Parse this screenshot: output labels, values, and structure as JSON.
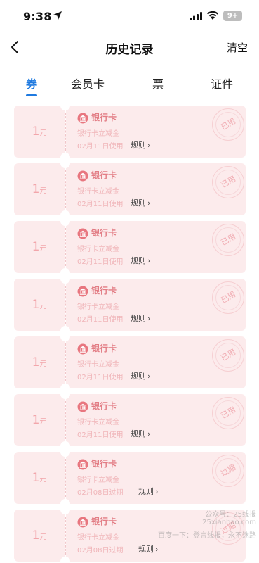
{
  "status": {
    "time": "9:38",
    "battery": "9+"
  },
  "nav": {
    "title": "历史记录",
    "clear_label": "清空",
    "back_icon": "chevron-left-icon"
  },
  "tabs": [
    "券",
    "会员卡",
    "票",
    "证件"
  ],
  "active_tab": "券",
  "colors": {
    "accent": "#1f7ae0",
    "coupon_bg": "#fcebec",
    "coupon_text": "#f0b5b9"
  },
  "coupons": [
    {
      "amount": "1",
      "unit": "元",
      "title": "银行卡",
      "subtitle": "银行卡立减金",
      "date": "02月11日使用",
      "rule": "规则",
      "stamp": "已用"
    },
    {
      "amount": "1",
      "unit": "元",
      "title": "银行卡",
      "subtitle": "银行卡立减金",
      "date": "02月11日使用",
      "rule": "规则",
      "stamp": "已用"
    },
    {
      "amount": "1",
      "unit": "元",
      "title": "银行卡",
      "subtitle": "银行卡立减金",
      "date": "02月11日使用",
      "rule": "规则",
      "stamp": "已用"
    },
    {
      "amount": "1",
      "unit": "元",
      "title": "银行卡",
      "subtitle": "银行卡立减金",
      "date": "02月11日使用",
      "rule": "规则",
      "stamp": "已用"
    },
    {
      "amount": "1",
      "unit": "元",
      "title": "银行卡",
      "subtitle": "银行卡立减金",
      "date": "02月11日使用",
      "rule": "规则",
      "stamp": "已用"
    },
    {
      "amount": "1",
      "unit": "元",
      "title": "银行卡",
      "subtitle": "银行卡立减金",
      "date": "02月11日使用",
      "rule": "规则",
      "stamp": "已用"
    },
    {
      "amount": "1",
      "unit": "元",
      "title": "银行卡",
      "subtitle": "银行卡立减金",
      "date": "02月08日过期",
      "rule": "规则",
      "stamp": "过期"
    },
    {
      "amount": "1",
      "unit": "元",
      "title": "银行卡",
      "subtitle": "银行卡立减金",
      "date": "02月08日过期",
      "rule": "规则",
      "stamp": "过期"
    }
  ],
  "watermark": {
    "line1": "公众号：25线报",
    "line2": "25xianbao.com",
    "line3": "百度一下：登言线报，永不迷路"
  }
}
